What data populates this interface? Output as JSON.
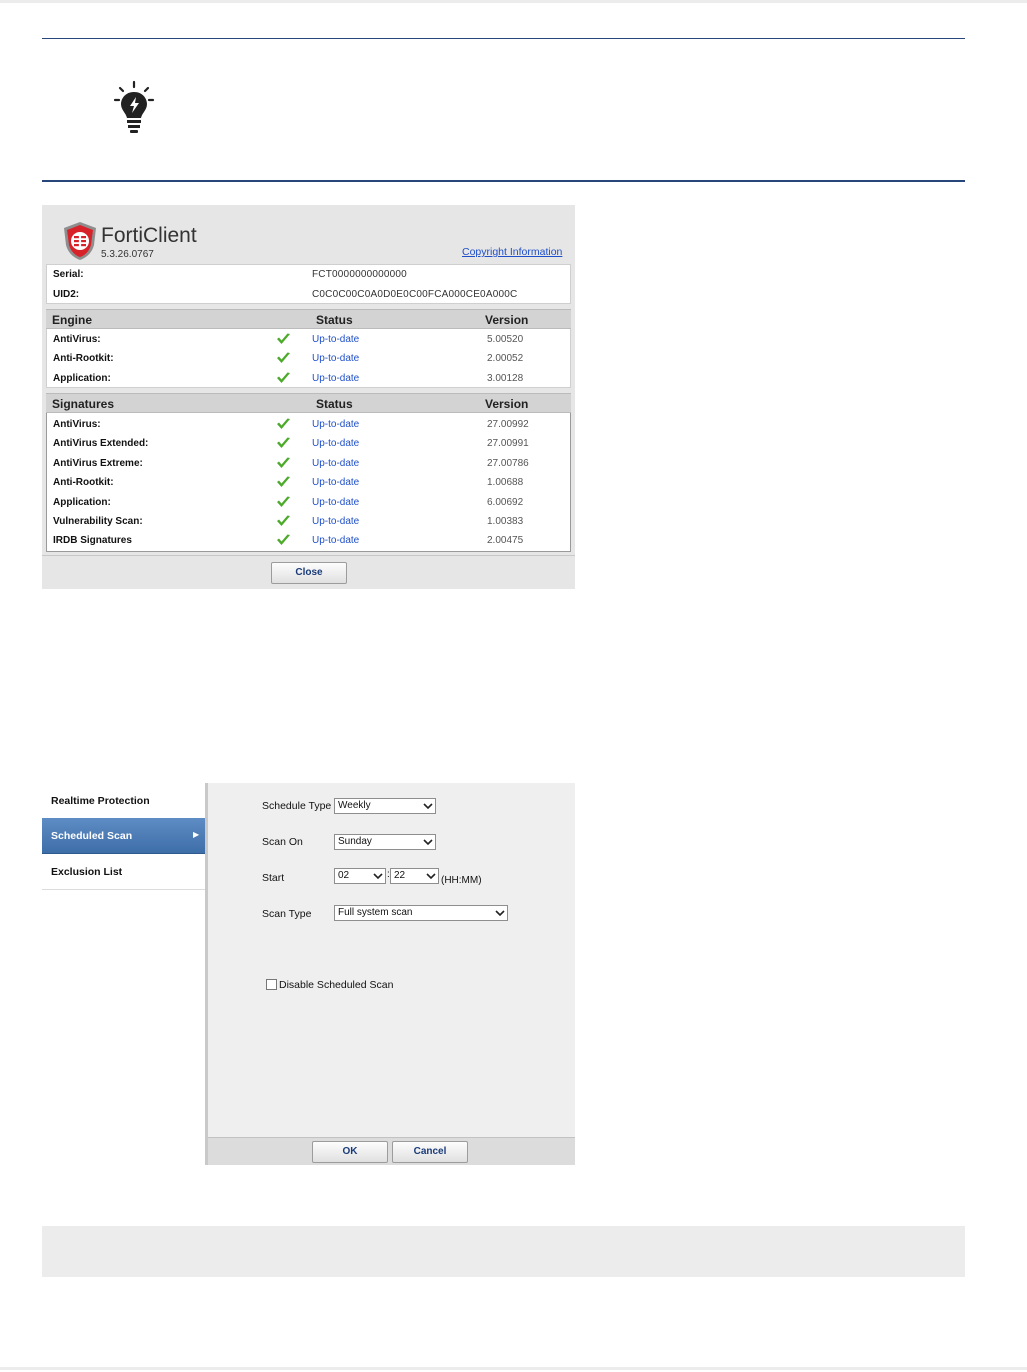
{
  "about": {
    "brand": "FortiClient",
    "build": "5.3.26.0767",
    "copyright_link": "Copyright Information",
    "serial_label": "Serial:",
    "serial_value": "FCT0000000000000",
    "uid_label": "UID2:",
    "uid_value": "C0C0C00C0A0D0E0C00FCA000CE0A000C",
    "engine_header": {
      "col1": "Engine",
      "col2": "Status",
      "col3": "Version"
    },
    "engine_rows": [
      {
        "name": "AntiVirus:",
        "status": "Up-to-date",
        "version": "5.00520"
      },
      {
        "name": "Anti-Rootkit:",
        "status": "Up-to-date",
        "version": "2.00052"
      },
      {
        "name": "Application:",
        "status": "Up-to-date",
        "version": "3.00128"
      }
    ],
    "signatures_header": {
      "col1": "Signatures",
      "col2": "Status",
      "col3": "Version"
    },
    "signature_rows": [
      {
        "name": "AntiVirus:",
        "status": "Up-to-date",
        "version": "27.00992"
      },
      {
        "name": "AntiVirus Extended:",
        "status": "Up-to-date",
        "version": "27.00991"
      },
      {
        "name": "AntiVirus Extreme:",
        "status": "Up-to-date",
        "version": "27.00786"
      },
      {
        "name": "Anti-Rootkit:",
        "status": "Up-to-date",
        "version": "1.00688"
      },
      {
        "name": "Application:",
        "status": "Up-to-date",
        "version": "6.00692"
      },
      {
        "name": "Vulnerability Scan:",
        "status": "Up-to-date",
        "version": "1.00383"
      },
      {
        "name": "IRDB Signatures",
        "status": "Up-to-date",
        "version": "2.00475"
      }
    ],
    "close_label": "Close"
  },
  "scheduled": {
    "sidebar": [
      "Realtime Protection",
      "Scheduled Scan",
      "Exclusion List"
    ],
    "schedule_type_label": "Schedule Type",
    "schedule_type_value": "Weekly",
    "scan_on_label": "Scan On",
    "scan_on_value": "Sunday",
    "start_label": "Start",
    "start_hour": "02",
    "start_minute": "22",
    "start_sep": ":",
    "start_format": "(HH:MM)",
    "scan_type_label": "Scan Type",
    "scan_type_value": "Full system scan",
    "disable_label": "Disable Scheduled Scan",
    "ok_label": "OK",
    "cancel_label": "Cancel"
  },
  "colors": {
    "accent_line": "#27477a",
    "link": "#1f4fc9",
    "check": "#4caa2a",
    "sidebar_active": "#4a7bb7"
  },
  "icons": [
    "lightbulb-icon",
    "forticlient-shield-icon",
    "check-icon",
    "chevron-right-icon",
    "dropdown-caret-icon"
  ]
}
